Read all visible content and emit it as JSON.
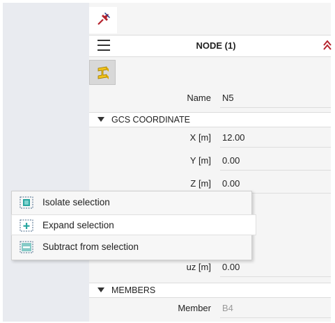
{
  "panel": {
    "title": "NODE (1)"
  },
  "properties": {
    "name_label": "Name",
    "name_value": "N5",
    "gcs_section": "GCS COORDINATE",
    "x_label": "X [m]",
    "x_value": "12.00",
    "y_label": "Y [m]",
    "y_value": "0.00",
    "z_label": "Z [m]",
    "z_value": "0.00",
    "uz_label": "uz [m]",
    "uz_value": "0.00",
    "members_section": "MEMBERS",
    "member_label": "Member",
    "member_value": "B4"
  },
  "context_menu": {
    "items": [
      {
        "label": "Isolate selection",
        "icon": "isolate-selection-icon"
      },
      {
        "label": "Expand selection",
        "icon": "expand-selection-icon"
      },
      {
        "label": "Subtract from selection",
        "icon": "subtract-selection-icon"
      }
    ]
  },
  "icons": {
    "pin": "pin-icon",
    "menu": "hamburger-menu-icon",
    "collapse": "double-chevron-up-icon",
    "filter": "beam-filter-icon"
  },
  "colors": {
    "accent_red": "#b5232d",
    "filter_yellow": "#f2c21a",
    "selection_teal": "#2aa6a0"
  }
}
